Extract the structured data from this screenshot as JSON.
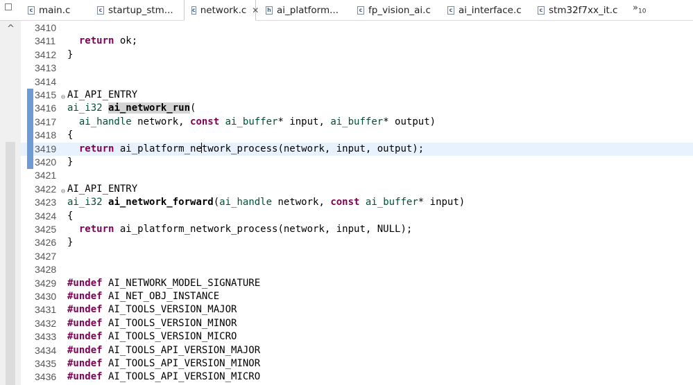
{
  "tabs": [
    {
      "icon": "c-file-icon",
      "glyph": "c",
      "label": "main.c",
      "active": false
    },
    {
      "icon": "c-file-icon",
      "glyph": "c",
      "label": "startup_stm...",
      "active": false
    },
    {
      "icon": "c-file-icon",
      "glyph": "c",
      "label": "network.c",
      "active": true
    },
    {
      "icon": "h-file-icon",
      "glyph": "h",
      "label": "ai_platform...",
      "active": false
    },
    {
      "icon": "c-file-icon",
      "glyph": "c",
      "label": "fp_vision_ai.c",
      "active": false
    },
    {
      "icon": "c-file-icon",
      "glyph": "c",
      "label": "ai_interface.c",
      "active": false
    },
    {
      "icon": "c-file-icon",
      "glyph": "c",
      "label": "stm32f7xx_it.c",
      "active": false
    }
  ],
  "overflow": {
    "chevron": "»",
    "count": "10"
  },
  "active_tab_close": "✕",
  "collapse_glyph": "^",
  "colors": {
    "keyword": "#7f0055",
    "type": "#005032",
    "current_line": "#e8f2fe",
    "marker": "#6f9bd4"
  },
  "lines": [
    {
      "n": "3410",
      "segs": []
    },
    {
      "n": "3411",
      "segs": [
        [
          "",
          "  "
        ],
        [
          "kw",
          "return"
        ],
        [
          "",
          " ok;"
        ]
      ]
    },
    {
      "n": "3412",
      "segs": [
        [
          "",
          "}"
        ]
      ]
    },
    {
      "n": "3413",
      "segs": []
    },
    {
      "n": "3414",
      "segs": []
    },
    {
      "n": "3415",
      "fold": true,
      "mark": true,
      "segs": [
        [
          "",
          "AI_API_ENTRY"
        ]
      ]
    },
    {
      "n": "3416",
      "mark": true,
      "segs": [
        [
          "ty",
          "ai_i32"
        ],
        [
          "",
          " "
        ],
        [
          "fn hl",
          "ai_network_run"
        ],
        [
          "",
          "("
        ]
      ]
    },
    {
      "n": "3417",
      "mark": true,
      "segs": [
        [
          "",
          "  "
        ],
        [
          "ty",
          "ai_handle"
        ],
        [
          "",
          " network, "
        ],
        [
          "kw",
          "const"
        ],
        [
          "",
          " "
        ],
        [
          "ty",
          "ai_buffer"
        ],
        [
          "",
          "* input, "
        ],
        [
          "ty",
          "ai_buffer"
        ],
        [
          "",
          "* output)"
        ]
      ]
    },
    {
      "n": "3418",
      "mark": true,
      "segs": [
        [
          "",
          "{"
        ]
      ]
    },
    {
      "n": "3419",
      "mark": true,
      "current": true,
      "segs": [
        [
          "",
          "  "
        ],
        [
          "kw",
          "return"
        ],
        [
          "",
          " ai_platform_ne"
        ],
        [
          "caret",
          ""
        ],
        [
          "",
          "twork_process(network, input, output);"
        ]
      ]
    },
    {
      "n": "3420",
      "mark": true,
      "segs": [
        [
          "",
          "}"
        ]
      ]
    },
    {
      "n": "3421",
      "segs": []
    },
    {
      "n": "3422",
      "fold": true,
      "segs": [
        [
          "",
          "AI_API_ENTRY"
        ]
      ]
    },
    {
      "n": "3423",
      "segs": [
        [
          "ty",
          "ai_i32"
        ],
        [
          "",
          " "
        ],
        [
          "fn",
          "ai_network_forward"
        ],
        [
          "",
          "("
        ],
        [
          "ty",
          "ai_handle"
        ],
        [
          "",
          " network, "
        ],
        [
          "kw",
          "const"
        ],
        [
          "",
          " "
        ],
        [
          "ty",
          "ai_buffer"
        ],
        [
          "",
          "* input)"
        ]
      ]
    },
    {
      "n": "3424",
      "segs": [
        [
          "",
          "{"
        ]
      ]
    },
    {
      "n": "3425",
      "segs": [
        [
          "",
          "  "
        ],
        [
          "kw",
          "return"
        ],
        [
          "",
          " ai_platform_network_process(network, input, NULL);"
        ]
      ]
    },
    {
      "n": "3426",
      "segs": [
        [
          "",
          "}"
        ]
      ]
    },
    {
      "n": "3427",
      "segs": []
    },
    {
      "n": "3428",
      "segs": []
    },
    {
      "n": "3429",
      "segs": [
        [
          "kw",
          "#undef"
        ],
        [
          "",
          " AI_NETWORK_MODEL_SIGNATURE"
        ]
      ]
    },
    {
      "n": "3430",
      "segs": [
        [
          "kw",
          "#undef"
        ],
        [
          "",
          " AI_NET_OBJ_INSTANCE"
        ]
      ]
    },
    {
      "n": "3431",
      "segs": [
        [
          "kw",
          "#undef"
        ],
        [
          "",
          " AI_TOOLS_VERSION_MAJOR"
        ]
      ]
    },
    {
      "n": "3432",
      "segs": [
        [
          "kw",
          "#undef"
        ],
        [
          "",
          " AI_TOOLS_VERSION_MINOR"
        ]
      ]
    },
    {
      "n": "3433",
      "segs": [
        [
          "kw",
          "#undef"
        ],
        [
          "",
          " AI_TOOLS_VERSION_MICRO"
        ]
      ]
    },
    {
      "n": "3434",
      "segs": [
        [
          "kw",
          "#undef"
        ],
        [
          "",
          " AI_TOOLS_API_VERSION_MAJOR"
        ]
      ]
    },
    {
      "n": "3435",
      "segs": [
        [
          "kw",
          "#undef"
        ],
        [
          "",
          " AI_TOOLS_API_VERSION_MINOR"
        ]
      ]
    },
    {
      "n": "3436",
      "segs": [
        [
          "kw",
          "#undef"
        ],
        [
          "",
          " AI_TOOLS_API_VERSION_MICRO"
        ]
      ]
    }
  ]
}
